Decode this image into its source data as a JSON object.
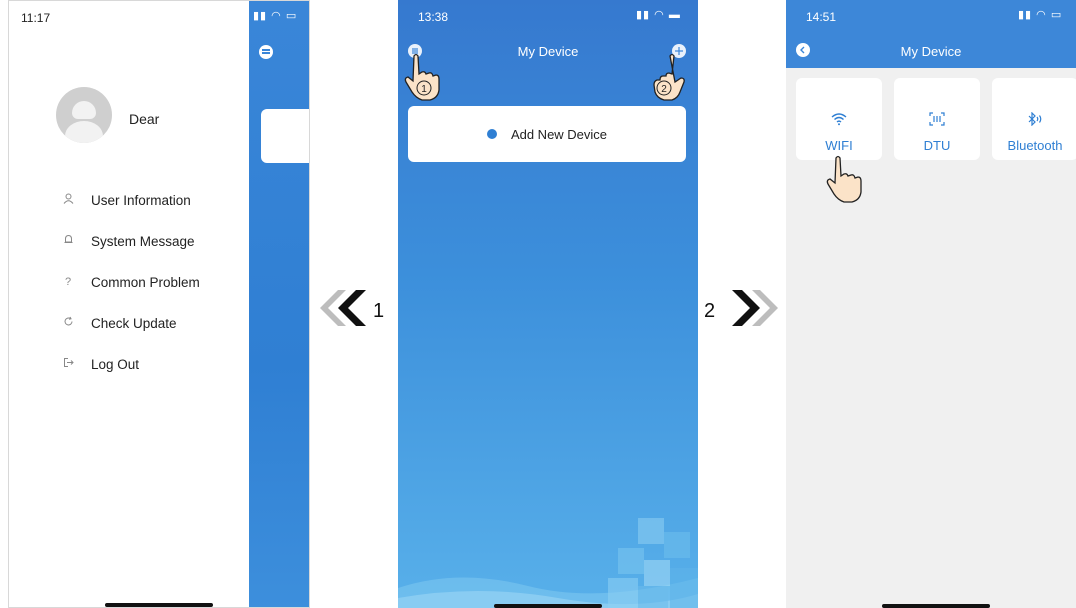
{
  "screen1": {
    "time": "11:17",
    "user_name": "Dear",
    "menu": [
      {
        "label": "User Information",
        "icon": "user-icon"
      },
      {
        "label": "System Message",
        "icon": "bell-icon"
      },
      {
        "label": "Common Problem",
        "icon": "question-icon"
      },
      {
        "label": "Check Update",
        "icon": "refresh-icon"
      },
      {
        "label": "Log Out",
        "icon": "logout-icon"
      }
    ]
  },
  "screen2": {
    "time": "13:38",
    "title": "My Device",
    "add_device_label": "Add New Device",
    "marker1": "1",
    "marker2": "2"
  },
  "screen3": {
    "time": "14:51",
    "title": "My Device",
    "tiles": [
      {
        "label": "WIFI",
        "icon": "wifi-icon"
      },
      {
        "label": "DTU",
        "icon": "dtu-icon"
      },
      {
        "label": "Bluetooth",
        "icon": "bluetooth-icon"
      }
    ]
  },
  "steps": {
    "left": "1",
    "right": "2"
  },
  "colors": {
    "primary": "#3a86d8",
    "accent": "#2f7fd3"
  }
}
